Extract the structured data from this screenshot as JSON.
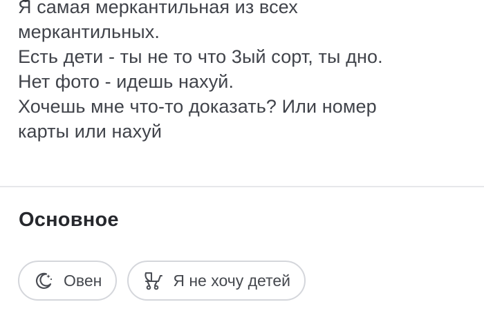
{
  "bio": {
    "lines": [
      "Я самая меркантильная из всех",
      "меркантильных.",
      "Есть дети - ты не то что 3ый сорт, ты дно.",
      "Нет фото - идешь нахуй.",
      "Хочешь мне что-то доказать? Или номер",
      "карты или нахуй"
    ]
  },
  "basics": {
    "title": "Основное",
    "chips": [
      {
        "icon": "moon-zodiac-icon",
        "label": "Овен"
      },
      {
        "icon": "stroller-icon",
        "label": "Я не хочу детей"
      }
    ]
  }
}
